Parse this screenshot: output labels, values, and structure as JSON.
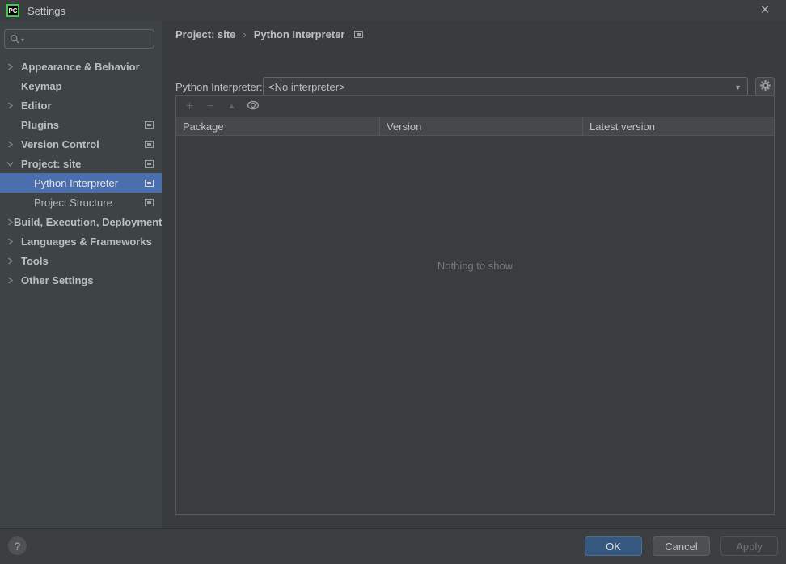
{
  "window": {
    "title": "Settings",
    "logo_text": "PC",
    "close_glyph": "×"
  },
  "colors": {
    "selection_blue": "#4b6eaf",
    "ok_button_blue": "#365880",
    "logo_green": "#3eca45",
    "sidebar_bg": "#3e4346",
    "content_bg": "#393c3e",
    "panel_bg": "#3a3d3f",
    "header_bg": "#45484a"
  },
  "sidebar": {
    "search": {
      "value": ""
    },
    "items": [
      {
        "label": "Appearance & Behavior"
      },
      {
        "label": "Keymap"
      },
      {
        "label": "Editor"
      },
      {
        "label": "Plugins"
      },
      {
        "label": "Version Control"
      },
      {
        "label": "Project: site"
      },
      {
        "label": "Python Interpreter"
      },
      {
        "label": "Project Structure"
      },
      {
        "label": "Build, Execution, Deployment"
      },
      {
        "label": "Languages & Frameworks"
      },
      {
        "label": "Tools"
      },
      {
        "label": "Other Settings"
      }
    ]
  },
  "breadcrumb": {
    "part1": "Project: site",
    "separator": "›",
    "part2": "Python Interpreter"
  },
  "interpreter": {
    "label": "Python Interpreter:",
    "value": "<No interpreter>",
    "dropdown_arrow": "▼"
  },
  "packages": {
    "toolbar": {
      "add_glyph": "+",
      "remove_glyph": "−",
      "upgrade_glyph": "▲"
    },
    "columns": [
      "Package",
      "Version",
      "Latest version"
    ],
    "rows": [],
    "empty_text": "Nothing to show"
  },
  "footer": {
    "help_glyph": "?",
    "ok_label": "OK",
    "cancel_label": "Cancel",
    "apply_label": "Apply"
  }
}
